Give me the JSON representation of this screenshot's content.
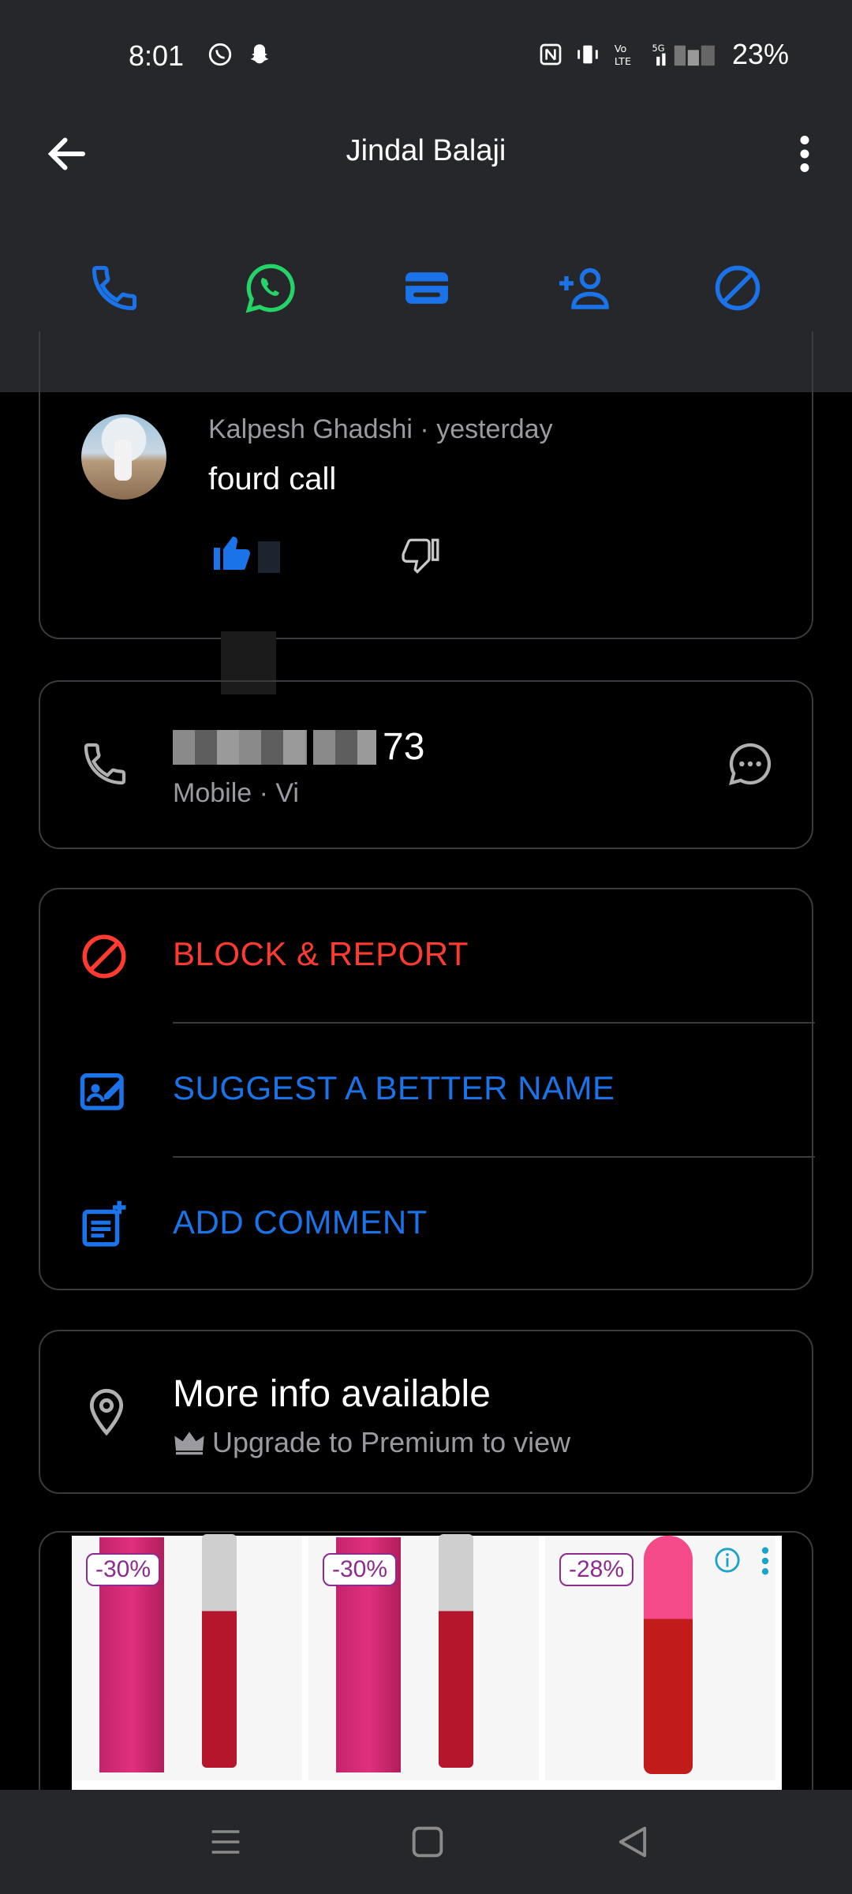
{
  "status_bar": {
    "time": "8:01",
    "battery": "23%",
    "left_icons": [
      "whatsapp-icon",
      "snapchat-icon"
    ],
    "right_icons": [
      "nfc-icon",
      "vibrate-icon",
      "volte-icon",
      "5g-signal-icon"
    ]
  },
  "toolbar": {
    "title": "Jindal Balaji"
  },
  "actions": [
    {
      "name": "call-button",
      "icon": "phone-icon",
      "color": "#1a73e8"
    },
    {
      "name": "whatsapp-button",
      "icon": "whatsapp-icon",
      "color": "#25d366"
    },
    {
      "name": "message-button",
      "icon": "card-icon",
      "color": "#1a73e8"
    },
    {
      "name": "add-contact-button",
      "icon": "add-person-icon",
      "color": "#1a73e8"
    },
    {
      "name": "block-button",
      "icon": "block-icon",
      "color": "#1a73e8"
    }
  ],
  "comment": {
    "author": "Kalpesh Ghadshi",
    "separator": "·",
    "when": "yesterday",
    "text": "fourd call"
  },
  "phone": {
    "number_suffix": "73",
    "type": "Mobile · Vi"
  },
  "action_rows": {
    "block": "BLOCK & REPORT",
    "suggest": "SUGGEST A BETTER NAME",
    "comment": "ADD COMMENT"
  },
  "info": {
    "title": "More info available",
    "subtitle": "Upgrade to Premium to view"
  },
  "ad": {
    "products": [
      {
        "discount": "-30%"
      },
      {
        "discount": "-30%"
      },
      {
        "discount": "-28%"
      }
    ]
  },
  "colors": {
    "accent": "#1a73e8",
    "danger": "#ff3b30",
    "whatsapp": "#25d366",
    "surface": "#26272b"
  }
}
